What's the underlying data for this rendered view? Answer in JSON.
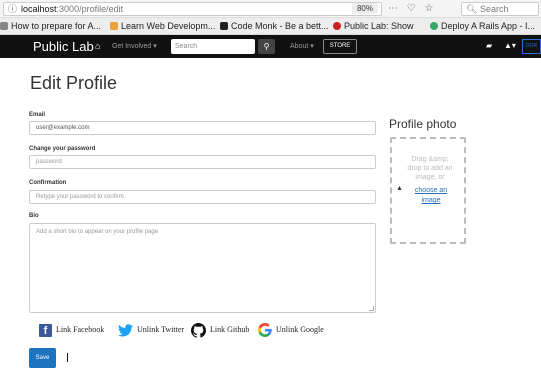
{
  "browser": {
    "url_host": "localhost",
    "url_path": ":3000/profile/edit",
    "zoom": "80%",
    "search_placeholder": "Search",
    "bookmarks": [
      {
        "label": "How to prepare for A...",
        "color": "#888888"
      },
      {
        "label": "Learn Web Developm...",
        "color": "#e8a33a"
      },
      {
        "label": "Code Monk - Be a bett...",
        "color": "#222222"
      },
      {
        "label": "Public Lab: Show",
        "color": "#cc2222"
      },
      {
        "label": "Deploy A Rails App - I...",
        "color": "#3aa66a"
      }
    ]
  },
  "navbar": {
    "brand": "Public Lab",
    "get_involved": "Get Involved ▾",
    "search_placeholder": "Search",
    "about": "About ▾",
    "store": "STORE",
    "dash": "DOR"
  },
  "form": {
    "title": "Edit Profile",
    "email_label": "Email",
    "email_value": "user@example.com",
    "password_label": "Change your password",
    "password_placeholder": "password",
    "confirmation_label": "Confirmation",
    "confirmation_placeholder": "Retype your password to confirm",
    "bio_label": "Bio",
    "bio_placeholder": "Add a short bio to appear on your profile page",
    "save": "Save"
  },
  "photo": {
    "title": "Profile photo",
    "drop_text": "Drag &amp; drop to add an image, or",
    "choose_link": "choose an image"
  },
  "social": {
    "facebook": "Link Facebook",
    "twitter": "Unlink Twitter",
    "github": "Link Github",
    "google": "Unlink Google"
  },
  "colors": {
    "navbar_bg": "#111111",
    "primary": "#1e73be",
    "link": "#2a6ebb",
    "facebook": "#3b5998",
    "twitter": "#1da1f2"
  }
}
